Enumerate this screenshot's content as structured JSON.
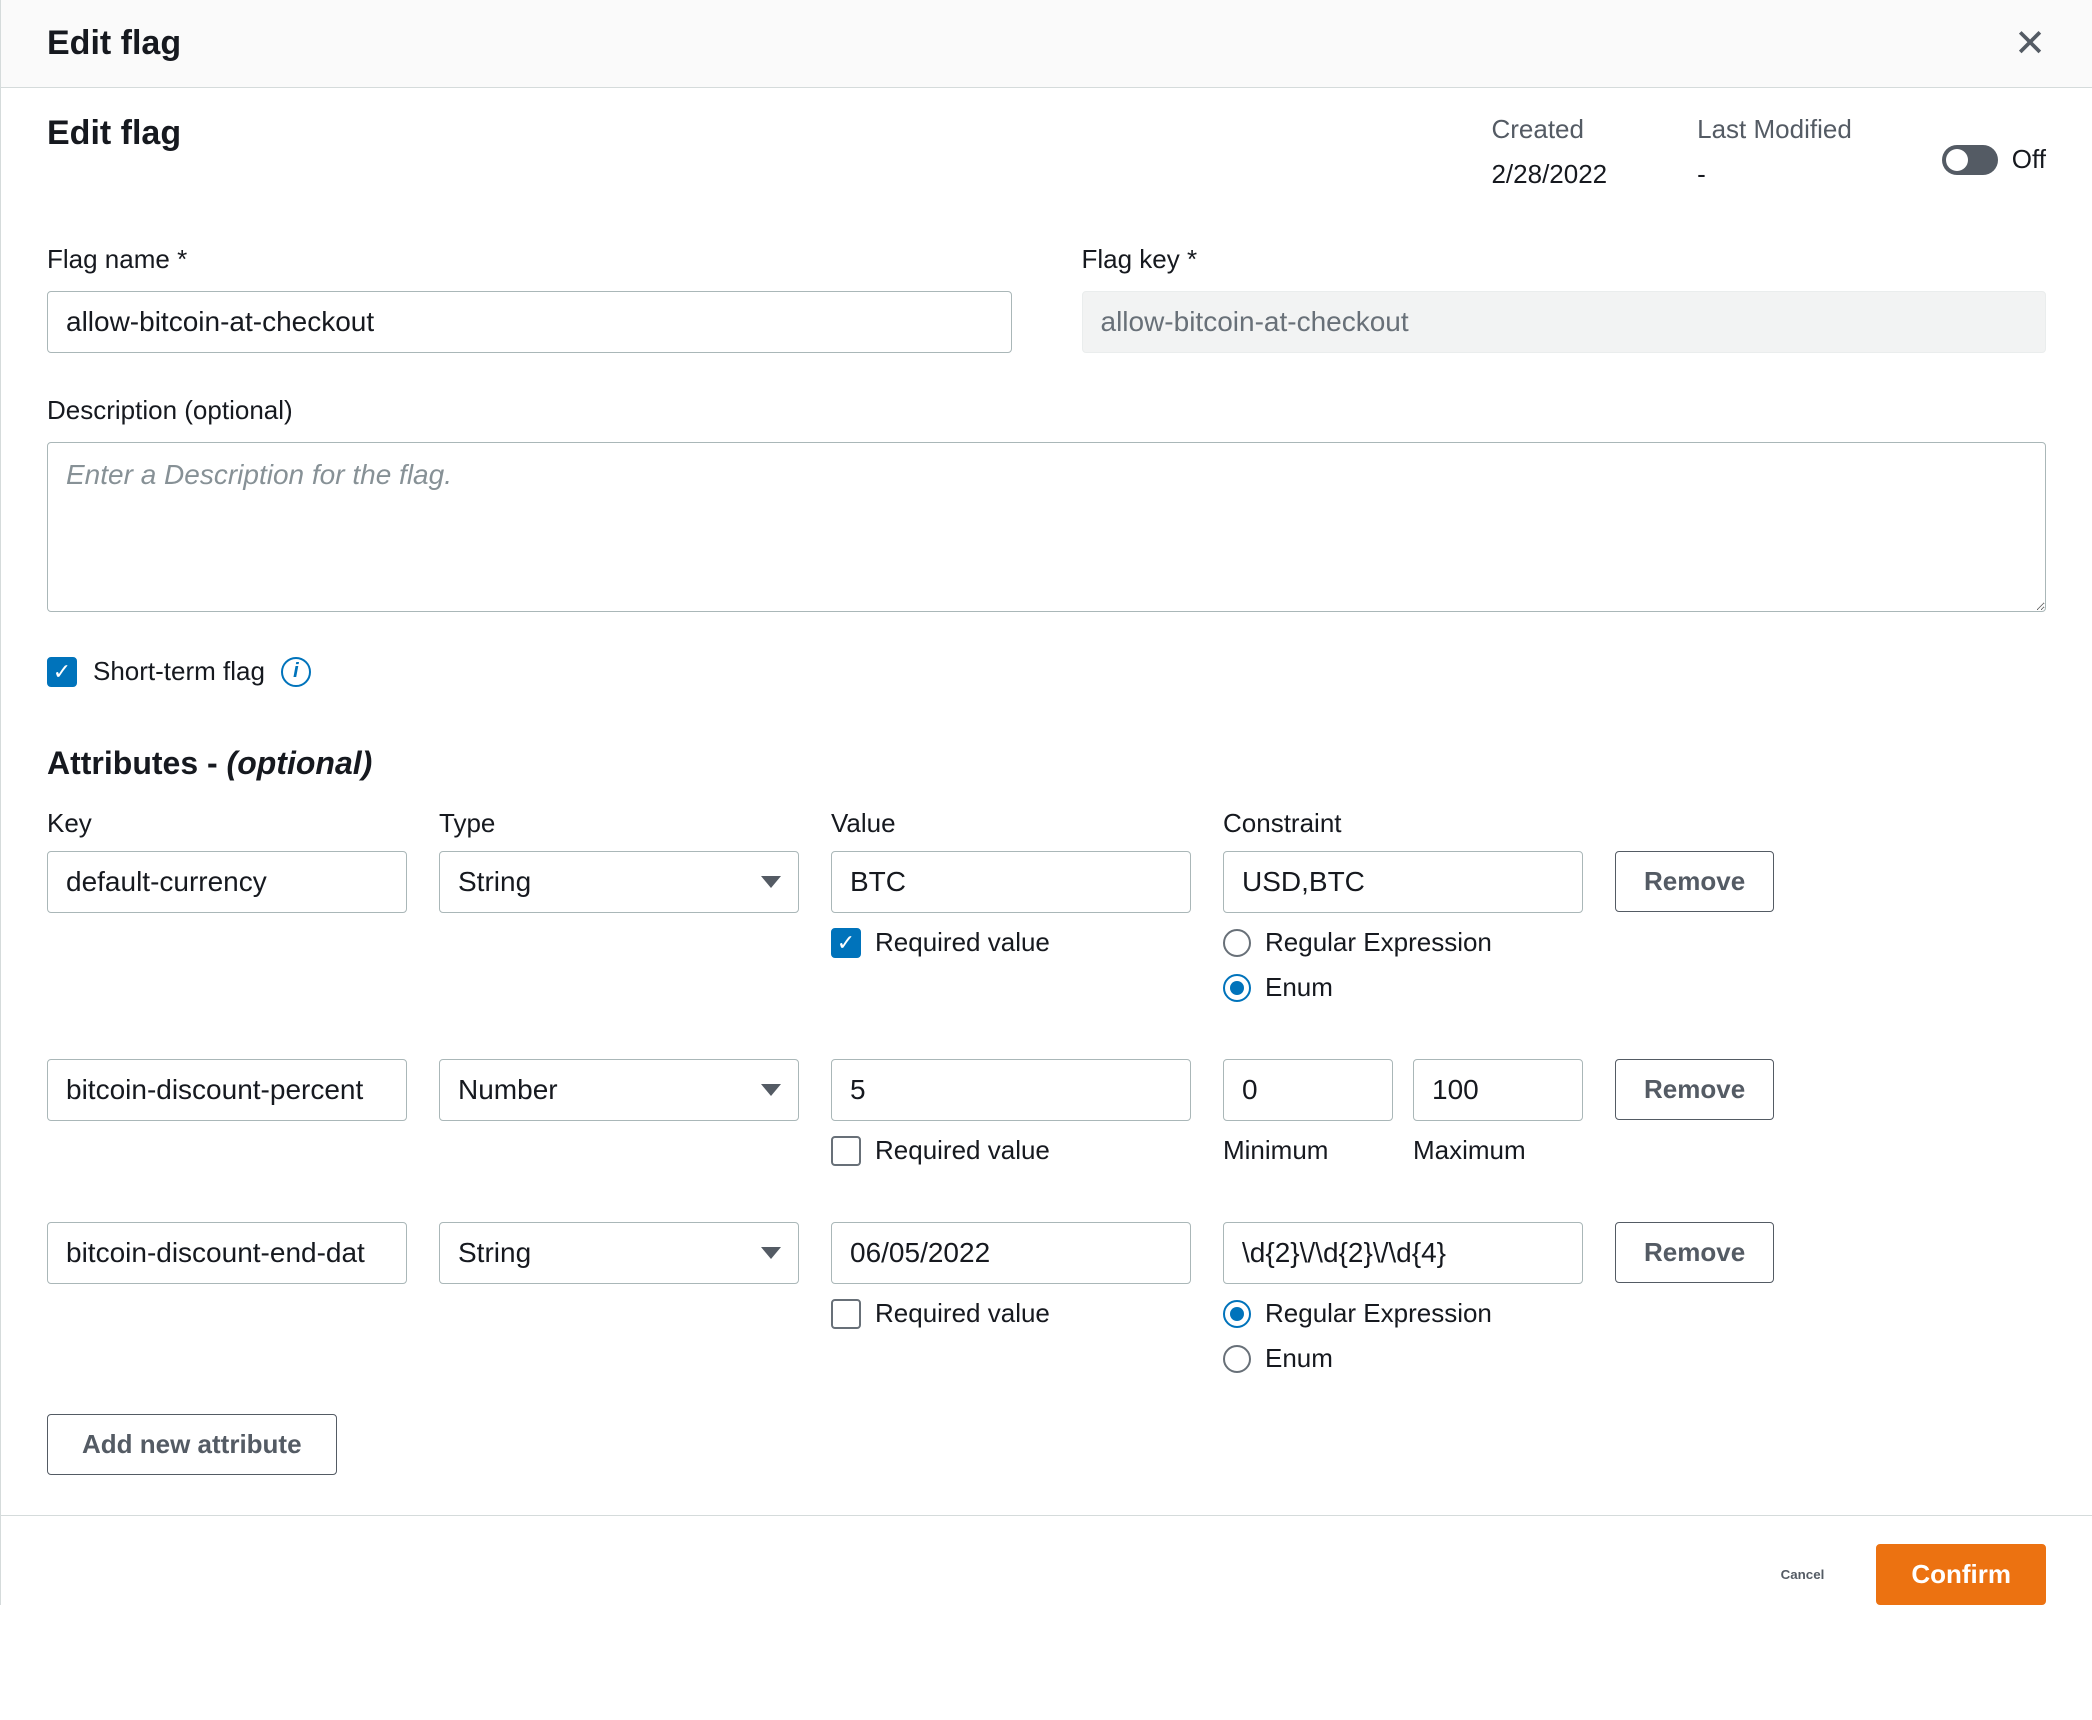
{
  "titlebar": {
    "title": "Edit flag"
  },
  "page": {
    "heading": "Edit flag",
    "created_label": "Created",
    "created_value": "2/28/2022",
    "modified_label": "Last Modified",
    "modified_value": "-",
    "toggle_state": "Off"
  },
  "form": {
    "flag_name_label": "Flag name *",
    "flag_name_value": "allow-bitcoin-at-checkout",
    "flag_key_label": "Flag key *",
    "flag_key_value": "allow-bitcoin-at-checkout",
    "description_label": "Description (optional)",
    "description_placeholder": "Enter a Description for the flag.",
    "short_term_label": "Short-term flag"
  },
  "attributes": {
    "heading_prefix": "Attributes - ",
    "heading_suffix": "(optional)",
    "col_key": "Key",
    "col_type": "Type",
    "col_value": "Value",
    "col_constraint": "Constraint",
    "required_label": "Required value",
    "regex_label": "Regular Expression",
    "enum_label": "Enum",
    "min_label": "Minimum",
    "max_label": "Maximum",
    "remove_label": "Remove",
    "add_label": "Add new attribute",
    "rows": [
      {
        "key": "default-currency",
        "type": "String",
        "value": "BTC",
        "required": true,
        "constraint_value": "USD,BTC",
        "constraint_mode": "enum"
      },
      {
        "key": "bitcoin-discount-percent",
        "type": "Number",
        "value": "5",
        "required": false,
        "min": "0",
        "max": "100"
      },
      {
        "key": "bitcoin-discount-end-dat",
        "type": "String",
        "value": "06/05/2022",
        "required": false,
        "constraint_value": "\\d{2}\\/\\d{2}\\/\\d{4}",
        "constraint_mode": "regex"
      }
    ]
  },
  "footer": {
    "cancel": "Cancel",
    "confirm": "Confirm"
  }
}
